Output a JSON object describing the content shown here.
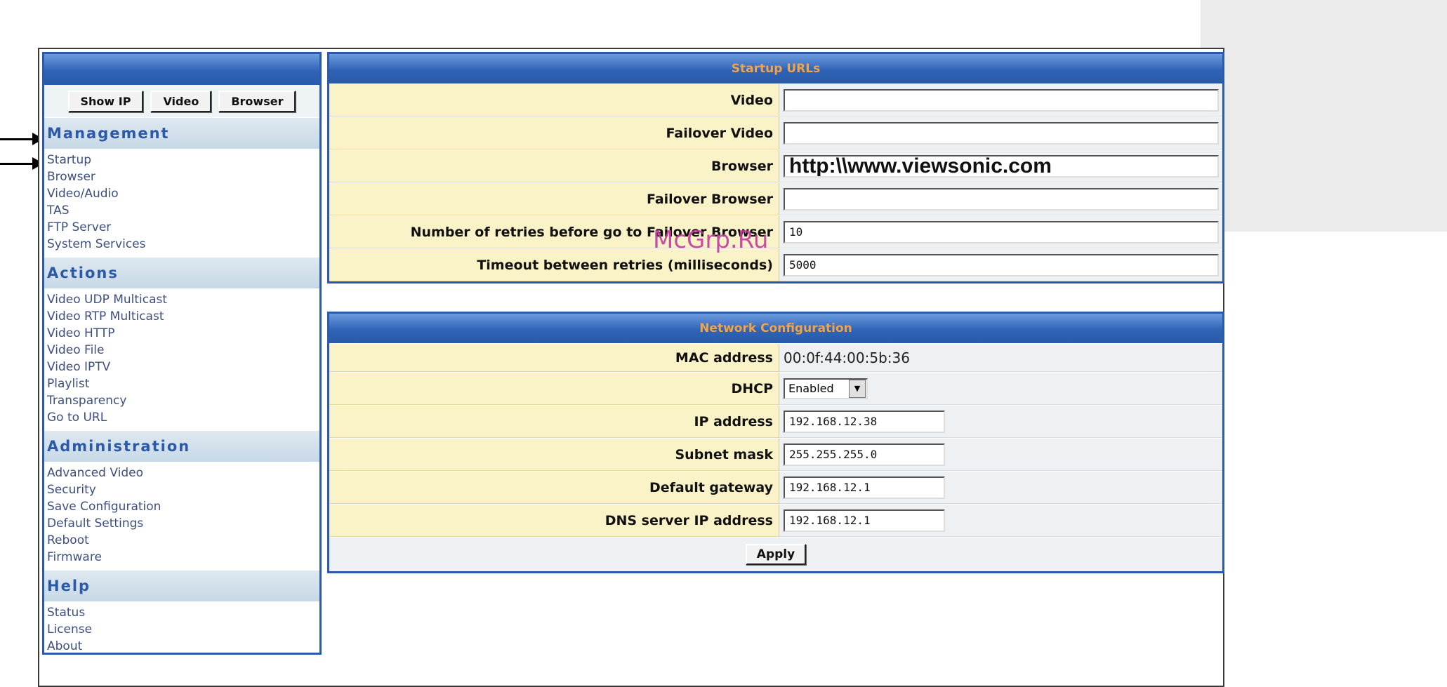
{
  "sidebar": {
    "buttons": [
      "Show IP",
      "Video",
      "Browser"
    ],
    "sections": [
      {
        "title": "Management",
        "items": [
          "Startup",
          "Browser",
          "Video/Audio",
          "TAS",
          "FTP Server",
          "System Services"
        ]
      },
      {
        "title": "Actions",
        "items": [
          "Video UDP Multicast",
          "Video RTP Multicast",
          "Video HTTP",
          "Video File",
          "Video IPTV",
          "Playlist",
          "Transparency",
          "Go to URL"
        ]
      },
      {
        "title": "Administration",
        "items": [
          "Advanced Video",
          "Security",
          "Save Configuration",
          "Default Settings",
          "Reboot",
          "Firmware"
        ]
      },
      {
        "title": "Help",
        "items": [
          "Status",
          "License",
          "About"
        ]
      }
    ]
  },
  "startup": {
    "title": "Startup URLs",
    "rows": [
      {
        "label": "Video",
        "value": ""
      },
      {
        "label": "Failover Video",
        "value": ""
      },
      {
        "label": "Browser",
        "value": "http:\\\\www.viewsonic.com"
      },
      {
        "label": "Failover Browser",
        "value": ""
      },
      {
        "label": "Number of retries before go to Failover Browser",
        "value": "10"
      },
      {
        "label": "Timeout between retries (milliseconds)",
        "value": "5000"
      }
    ]
  },
  "network": {
    "title": "Network Configuration",
    "mac_label": "MAC address",
    "mac_value": "00:0f:44:00:5b:36",
    "dhcp_label": "DHCP",
    "dhcp_value": "Enabled",
    "rows": [
      {
        "label": "IP address",
        "value": "192.168.12.38"
      },
      {
        "label": "Subnet mask",
        "value": "255.255.255.0"
      },
      {
        "label": "Default gateway",
        "value": "192.168.12.1"
      },
      {
        "label": "DNS server IP address",
        "value": "192.168.12.1"
      }
    ],
    "apply_label": "Apply"
  },
  "watermark": "McGrp.Ru",
  "colors": {
    "accent": "#2c5aa8",
    "header_text": "#f0a34a",
    "label_bg": "#fbf3c8"
  }
}
